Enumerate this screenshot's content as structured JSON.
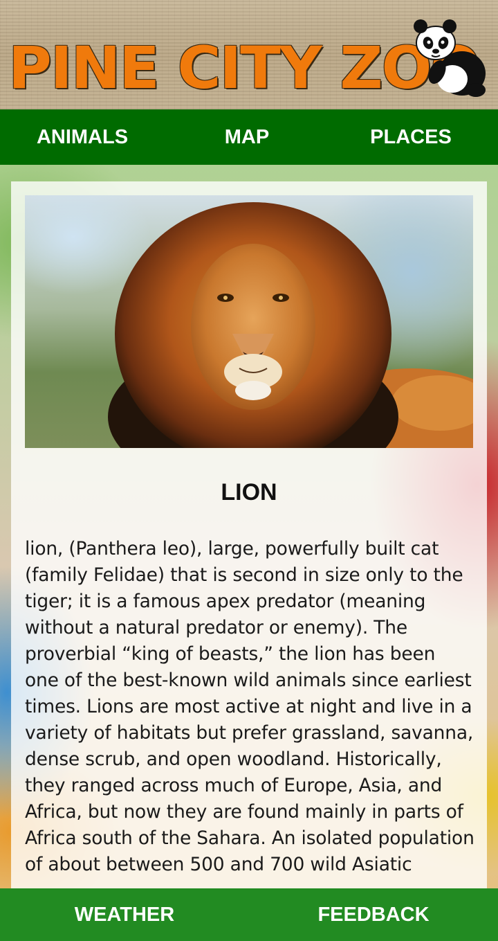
{
  "header": {
    "logo_text": "PINE CITY ZOO",
    "mascot_icon": "panda-icon"
  },
  "topnav": {
    "items": [
      {
        "label": "ANIMALS"
      },
      {
        "label": "MAP"
      },
      {
        "label": "PLACES"
      }
    ]
  },
  "animal": {
    "name": "LION",
    "image_icon": "lion-photo",
    "description": "lion, (Panthera leo), large, powerfully built cat (family Felidae) that is second in size only to the tiger; it is a famous apex predator (meaning without a natural predator or enemy). The proverbial “king of beasts,” the lion has been one of the best-known wild animals since earliest times. Lions are most active at night and live in a variety of habitats but prefer grassland, savanna, dense scrub, and open woodland. Historically, they ranged across much of Europe, Asia, and Africa, but now they are found mainly in parts of Africa south of the Sahara. An isolated population of about between 500 and 700 wild Asiatic"
  },
  "bottomnav": {
    "items": [
      {
        "label": "WEATHER"
      },
      {
        "label": "FEEDBACK"
      }
    ]
  },
  "colors": {
    "topnav_bg": "#006b00",
    "bottomnav_bg": "#228b22",
    "logo_orange": "#f07a0c"
  }
}
